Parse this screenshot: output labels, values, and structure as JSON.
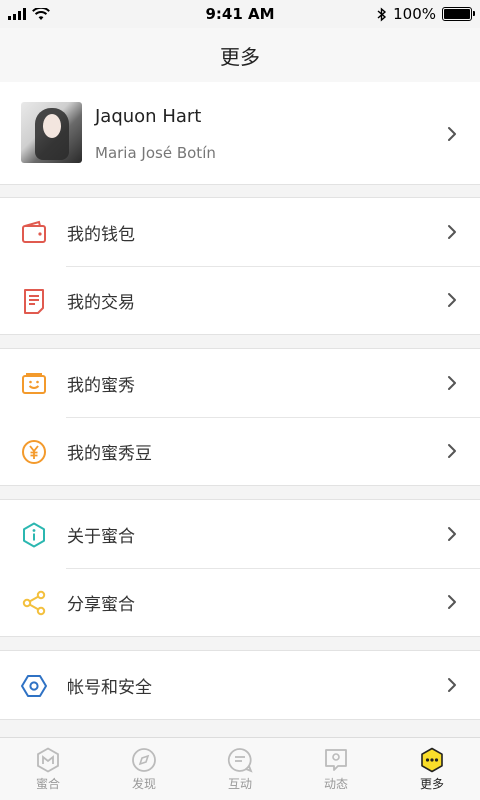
{
  "status_bar": {
    "time": "9:41 AM",
    "battery": "100%"
  },
  "navbar": {
    "title": "更多"
  },
  "profile": {
    "name": "Jaquon Hart",
    "subtitle": "Maria José Botín"
  },
  "menu": {
    "wallet": "我的钱包",
    "trade": "我的交易",
    "show": "我的蜜秀",
    "beans": "我的蜜秀豆",
    "about": "关于蜜合",
    "share": "分享蜜合",
    "security": "帐号和安全"
  },
  "tabs": [
    {
      "label": "蜜合",
      "icon": "mihe-icon"
    },
    {
      "label": "发现",
      "icon": "compass-icon"
    },
    {
      "label": "互动",
      "icon": "chat-icon"
    },
    {
      "label": "动态",
      "icon": "feed-icon"
    },
    {
      "label": "更多",
      "icon": "more-icon"
    }
  ],
  "colors": {
    "wallet": "#e05a4f",
    "trade": "#e05a4f",
    "show": "#f39a2c",
    "beans": "#f39a2c",
    "about": "#2bb7b0",
    "share": "#f3c03e",
    "security": "#2f72c4",
    "active_tab": "#f9dd2a"
  }
}
